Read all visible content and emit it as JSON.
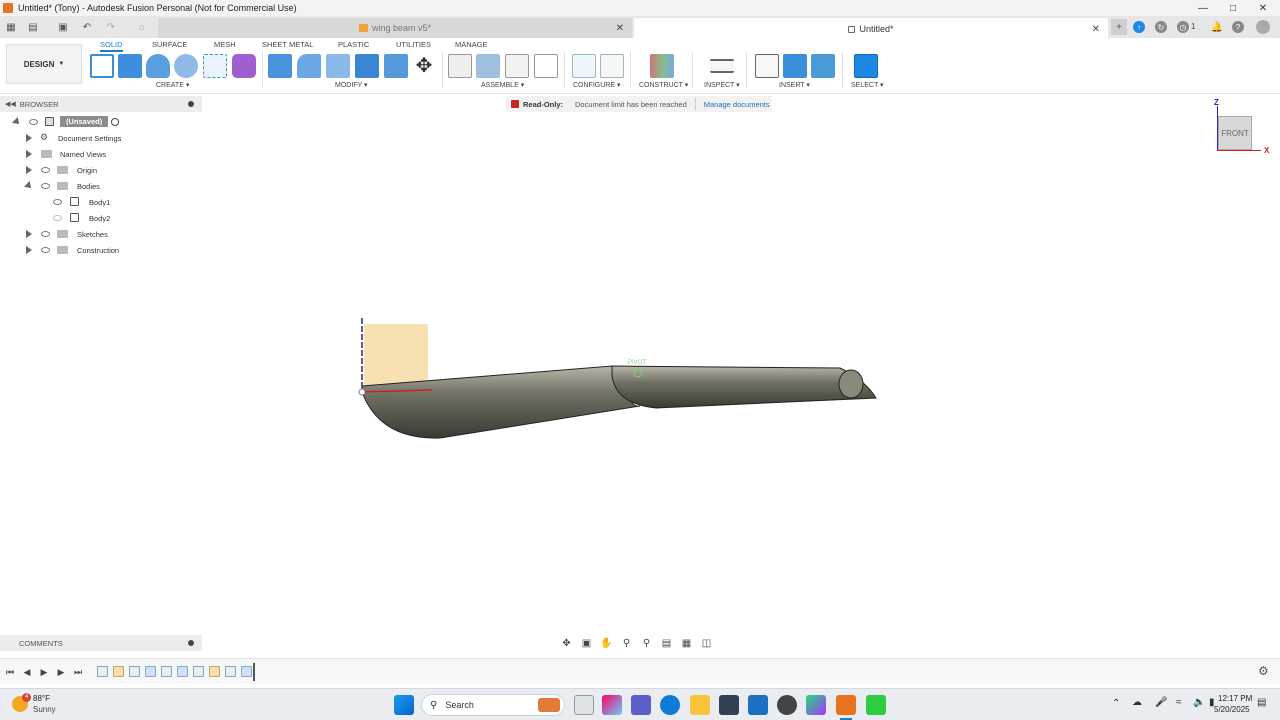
{
  "window": {
    "title": "Untitled* (Tony) - Autodesk Fusion Personal (Not for Commercial Use)"
  },
  "tabs": [
    {
      "label": "wing beam v5*",
      "active": false
    },
    {
      "label": "Untitled*",
      "active": true
    }
  ],
  "header_badge": "1",
  "workspace": {
    "label": "DESIGN",
    "tabs": [
      "SOLID",
      "SURFACE",
      "MESH",
      "SHEET METAL",
      "PLASTIC",
      "UTILITIES",
      "MANAGE"
    ],
    "active_tab": "SOLID"
  },
  "toolbar_groups": [
    "CREATE",
    "MODIFY",
    "ASSEMBLE",
    "CONFIGURE",
    "CONSTRUCT",
    "INSPECT",
    "INSERT",
    "SELECT"
  ],
  "banner": {
    "title": "Read-Only:",
    "message": "Document limit has been reached",
    "link": "Manage documents"
  },
  "browser": {
    "title": "BROWSER",
    "root": "(Unsaved)",
    "items": [
      {
        "label": "Document Settings"
      },
      {
        "label": "Named Views"
      },
      {
        "label": "Origin"
      },
      {
        "label": "Bodies"
      },
      {
        "label": "Body1"
      },
      {
        "label": "Body2"
      },
      {
        "label": "Sketches"
      },
      {
        "label": "Construction"
      }
    ]
  },
  "viewcube": {
    "face": "FRONT",
    "axis_z": "Z",
    "axis_x": "X"
  },
  "viewport": {
    "pivot_label": "PIVOT"
  },
  "comments": {
    "title": "COMMENTS"
  },
  "taskbar": {
    "weather_temp": "88°F",
    "weather_desc": "Sunny",
    "weather_badge": "4",
    "search_placeholder": "Search",
    "time": "12:17 PM",
    "date": "5/20/2025"
  },
  "colors": {
    "accent": "#1e7ecc",
    "readonly_red": "#c62828",
    "sketch_plane": "#f5d9a0"
  }
}
